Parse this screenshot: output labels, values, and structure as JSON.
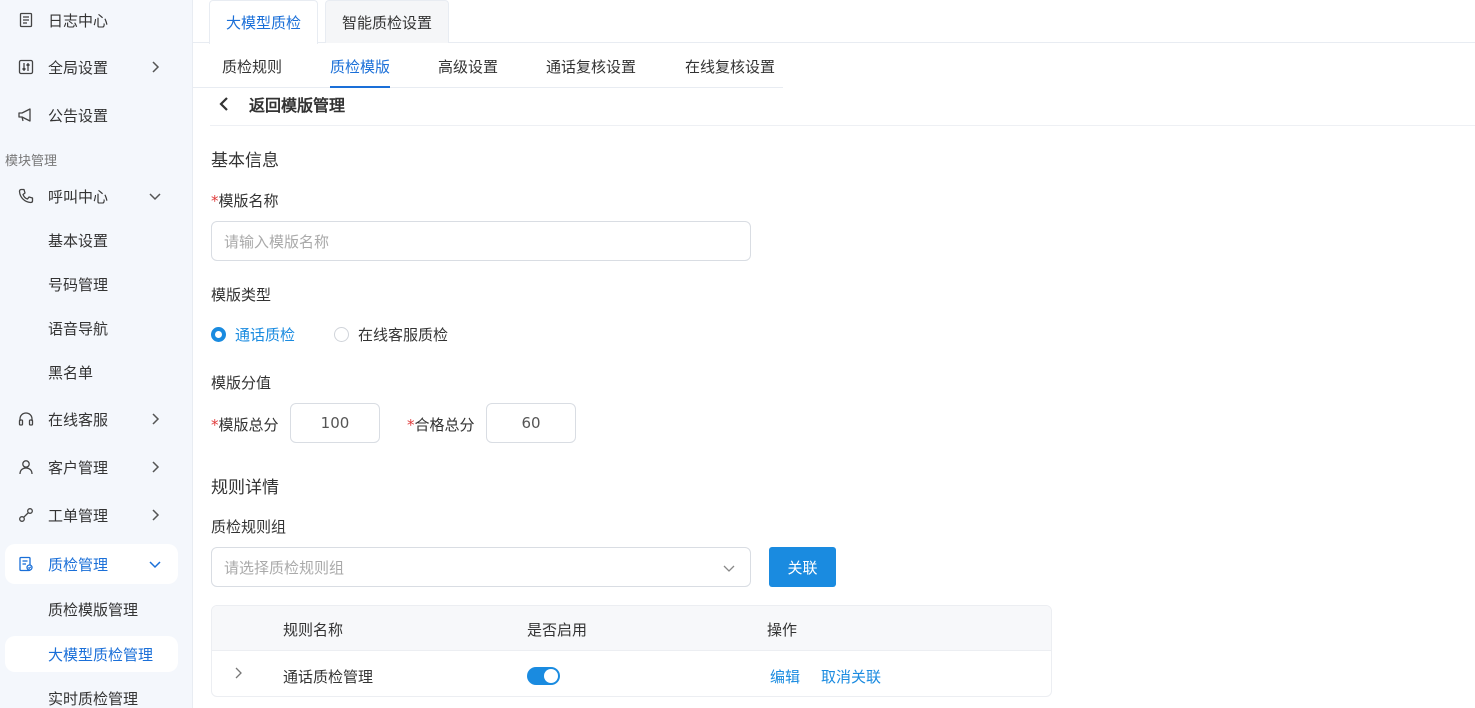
{
  "sidebar": {
    "section_label": "模块管理",
    "items": [
      {
        "label": "日志中心",
        "icon": "log-icon"
      },
      {
        "label": "全局设置",
        "icon": "settings-icon"
      },
      {
        "label": "公告设置",
        "icon": "megaphone-icon"
      },
      {
        "label": "呼叫中心",
        "icon": "phone-icon"
      },
      {
        "label": "在线客服",
        "icon": "headset-icon"
      },
      {
        "label": "客户管理",
        "icon": "user-icon"
      },
      {
        "label": "工单管理",
        "icon": "tool-icon"
      },
      {
        "label": "质检管理",
        "icon": "inspection-icon"
      }
    ],
    "call_center_sub": [
      "基本设置",
      "号码管理",
      "语音导航",
      "黑名单"
    ],
    "qc_sub": [
      "质检模版管理",
      "大模型质检管理",
      "实时质检管理"
    ]
  },
  "top_tabs": [
    "大模型质检",
    "智能质检设置"
  ],
  "sub_tabs": [
    "质检规则",
    "质检模版",
    "高级设置",
    "通话复核设置",
    "在线复核设置"
  ],
  "back_label": "返回模版管理",
  "form": {
    "basic_info_title": "基本信息",
    "name_label": "模版名称",
    "name_placeholder": "请输入模版名称",
    "type_label": "模版类型",
    "type_options": [
      "通话质检",
      "在线客服质检"
    ],
    "score_title": "模版分值",
    "total_label": "模版总分",
    "total_value": "100",
    "pass_label": "合格总分",
    "pass_value": "60",
    "rules_title": "规则详情",
    "rule_group_label": "质检规则组",
    "rule_group_placeholder": "请选择质检规则组",
    "link_button": "关联"
  },
  "table": {
    "headers": [
      "规则名称",
      "是否启用",
      "操作"
    ],
    "rows": [
      {
        "name": "通话质检管理",
        "enabled": true,
        "actions": [
          "编辑",
          "取消关联"
        ]
      }
    ]
  },
  "colors": {
    "accent": "#1a8be0",
    "active_text": "#1a6fd8",
    "required": "#e03c3c"
  }
}
